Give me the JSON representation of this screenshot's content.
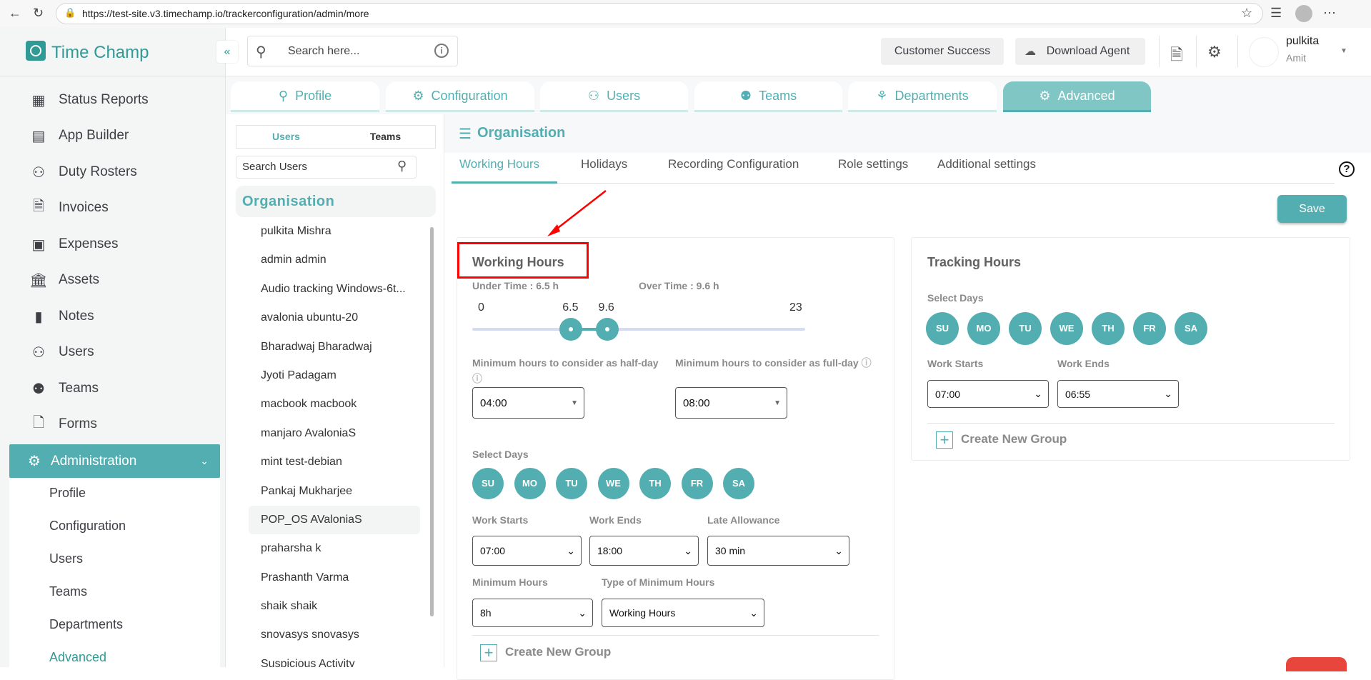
{
  "browser": {
    "url": "https://test-site.v3.timechamp.io/trackerconfiguration/admin/more"
  },
  "app": {
    "name": "Time Champ",
    "collapse_icon": "«"
  },
  "sidebar": {
    "items": [
      {
        "label": "Status Reports",
        "icon": "▦"
      },
      {
        "label": "App Builder",
        "icon": "▤"
      },
      {
        "label": "Duty Rosters",
        "icon": "⚇"
      },
      {
        "label": "Invoices",
        "icon": "🗎"
      },
      {
        "label": "Expenses",
        "icon": "▣"
      },
      {
        "label": "Assets",
        "icon": "🏛"
      },
      {
        "label": "Notes",
        "icon": "▮"
      },
      {
        "label": "Users",
        "icon": "⚇"
      },
      {
        "label": "Teams",
        "icon": "⚉"
      },
      {
        "label": "Forms",
        "icon": "🗋"
      }
    ],
    "admin": {
      "label": "Administration",
      "icon": "⚙",
      "chevron": "⌄"
    },
    "sub_items": [
      "Profile",
      "Configuration",
      "Users",
      "Teams",
      "Departments",
      "Advanced"
    ]
  },
  "header": {
    "search_placeholder": "Search here...",
    "customer_success": "Customer Success",
    "download_agent": "Download Agent",
    "user_name": "pulkita",
    "user_role": "Amit"
  },
  "top_tabs": [
    {
      "label": "Profile",
      "icon": "⚲"
    },
    {
      "label": "Configuration",
      "icon": "⚙"
    },
    {
      "label": "Users",
      "icon": "⚇"
    },
    {
      "label": "Teams",
      "icon": "⚉"
    },
    {
      "label": "Departments",
      "icon": "⚘"
    },
    {
      "label": "Advanced",
      "icon": "⚙"
    }
  ],
  "users_panel": {
    "toggle": [
      "Users",
      "Teams"
    ],
    "search_placeholder": "Search Users",
    "org": "Organisation",
    "users": [
      "pulkita Mishra",
      "admin admin",
      "Audio tracking Windows-6t...",
      "avalonia ubuntu-20",
      "Bharadwaj Bharadwaj",
      "Jyoti Padagam",
      "macbook macbook",
      "manjaro AvaloniaS",
      "mint test-debian",
      "Pankaj Mukharjee",
      "POP_OS AValoniaS",
      "praharsha k",
      "Prashanth Varma",
      "shaik shaik",
      "snovasys snovasys",
      "Suspicious Activity"
    ]
  },
  "main": {
    "title": "Organisation",
    "tabs": [
      "Working Hours",
      "Holidays",
      "Recording Configuration",
      "Role settings",
      "Additional settings"
    ],
    "help": "?",
    "save": "Save"
  },
  "working_hours": {
    "title": "Working Hours",
    "under_time": "Under Time : 6.5 h",
    "over_time": "Over Time : 9.6 h",
    "slider": {
      "min": 0,
      "max": 23,
      "low": 6.5,
      "high": 9.6,
      "min_label": "0",
      "max_label": "23",
      "low_label": "6.5",
      "high_label": "9.6"
    },
    "half_day_label": "Minimum hours to consider as half-day",
    "half_day_value": "04:00",
    "full_day_label": "Minimum hours to consider as full-day",
    "full_day_value": "08:00",
    "select_days": "Select Days",
    "days": [
      "SU",
      "MO",
      "TU",
      "WE",
      "TH",
      "FR",
      "SA"
    ],
    "work_starts_label": "Work Starts",
    "work_starts": "07:00",
    "work_ends_label": "Work Ends",
    "work_ends": "18:00",
    "late_label": "Late Allowance",
    "late": "30 min",
    "min_hours_label": "Minimum Hours",
    "min_hours": "8h",
    "type_label": "Type of Minimum Hours",
    "type": "Working Hours",
    "create_group": "Create New Group"
  },
  "tracking_hours": {
    "title": "Tracking Hours",
    "select_days": "Select Days",
    "days": [
      "SU",
      "MO",
      "TU",
      "WE",
      "TH",
      "FR",
      "SA"
    ],
    "work_starts_label": "Work Starts",
    "work_starts": "07:00",
    "work_ends_label": "Work Ends",
    "work_ends": "06:55",
    "create_group": "Create New Group"
  },
  "colors": {
    "accent": "#52aeb0",
    "annotation": "#ff0000"
  }
}
